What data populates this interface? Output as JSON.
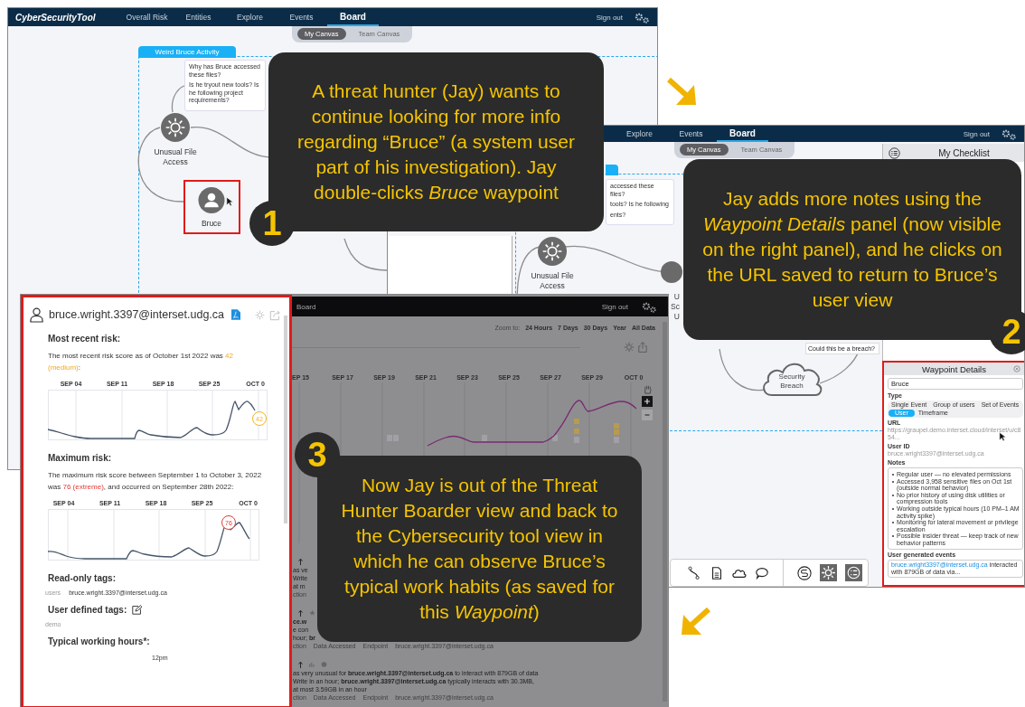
{
  "screen_board": {
    "app_title": "CyberSecurityTool",
    "nav": [
      {
        "label": "Overall Risk",
        "selected": false
      },
      {
        "label": "Entities",
        "selected": false
      },
      {
        "label": "Explore",
        "selected": false
      },
      {
        "label": "Events",
        "selected": false
      },
      {
        "label": "Board",
        "selected": true
      }
    ],
    "sign_out": "Sign out",
    "canvas_tabs": [
      {
        "label": "My Canvas",
        "selected": true
      },
      {
        "label": "Team Canvas",
        "selected": false
      }
    ],
    "group_label": "Weird Bruce Activity",
    "note": [
      "Why has Bruce accessed these files?",
      "Is he tryout new tools? Is he following project requirements?"
    ],
    "nodes": [
      {
        "label": "Unusual File Access",
        "kind": "event",
        "highlighted": false
      },
      {
        "label": "Bruce",
        "kind": "user",
        "highlighted": true
      }
    ]
  },
  "screen_details": {
    "nav": [
      {
        "label": "Explore",
        "selected": false
      },
      {
        "label": "Events",
        "selected": false
      },
      {
        "label": "Board",
        "selected": true
      }
    ],
    "sign_out": "Sign out",
    "canvas_tabs": [
      {
        "label": "My Canvas",
        "selected": true
      },
      {
        "label": "Team Canvas",
        "selected": false
      }
    ],
    "checklist_title": "My Checklist",
    "note_fragments": [
      "accessed these files?",
      "tools? Is he following",
      "ents?"
    ],
    "nodes": [
      {
        "label": "Unusual File Access",
        "kind": "event"
      },
      {
        "label": "Security Breach",
        "kind": "cloud"
      }
    ],
    "node_label_fragments": [
      "U",
      "Sc",
      "U"
    ],
    "breach_note": "Could this be a breach?",
    "waypoint_details": {
      "title": "Waypoint Details",
      "name": "Bruce",
      "type_label": "Type",
      "types": [
        {
          "label": "Single Event",
          "selected": false
        },
        {
          "label": "Group of users",
          "selected": false
        },
        {
          "label": "Set of Events",
          "selected": false
        },
        {
          "label": "User",
          "selected": true
        },
        {
          "label": "Timeframe",
          "selected": false
        }
      ],
      "url_label": "URL",
      "url": "https://graupel.demo.interset.cloud/interset/u/c854...",
      "user_id_label": "User ID",
      "user_id": "bruce.wright3397@interset.udg.ca",
      "notes_label": "Notes",
      "notes": [
        "Regular user — no elevated permissions",
        "Accessed 3,958 sensitive files on Oct 1st (outside normal behavior)",
        "No prior history of using disk utilities or compression tools",
        "Working outside typical hours (10 PM–1 AM activity spike)",
        "Monitoring for lateral movement or privilege escalation",
        "Possible insider threat — keep track of new behavior patterns"
      ],
      "events_label": "User generated events",
      "event": {
        "user": "bruce.wright3397@interset.udg.ca",
        "text": "interacted with 879GB of data via..."
      }
    }
  },
  "screen_user": {
    "email": "bruce.wright.3397@interset.udg.ca",
    "recent_risk": {
      "heading": "Most recent risk:",
      "text": "The most recent risk score as of October 1st 2022 was",
      "score": "42 (medium)",
      "after": ":",
      "ticks": [
        "SEP 04",
        "SEP 11",
        "SEP 18",
        "SEP 25",
        "OCT 0"
      ],
      "badge": "42"
    },
    "max_risk": {
      "heading": "Maximum risk:",
      "text": "The maximum risk score between September 1 to October 3, 2022 was",
      "score": "76 (extreme)",
      "after": ", and occurred on September 28th 2022:",
      "ticks": [
        "SEP 04",
        "SEP 11",
        "SEP 18",
        "SEP 25",
        "OCT 0"
      ],
      "badge": "76"
    },
    "readonly_tags": {
      "heading": "Read-only tags:",
      "label": "users",
      "value": "bruce.wright.3397@interset.udg.ca"
    },
    "user_tags": {
      "heading": "User defined tags:",
      "value": "demo"
    },
    "hours": {
      "heading": "Typical working hours*:",
      "tick": "12pm"
    },
    "tab": "Board",
    "sign_out": "Sign out",
    "zoom_label": "Zoom to:",
    "zoom_options": [
      "24 Hours",
      "7 Days",
      "30 Days",
      "Year",
      "All Data"
    ],
    "timeline_ticks": [
      "EP 15",
      "SEP 17",
      "SEP 19",
      "SEP 21",
      "SEP 23",
      "SEP 25",
      "SEP 27",
      "SEP 29",
      "OCT 0"
    ],
    "events": [
      {
        "kind": "pin",
        "lines": [
          "as ve",
          "Write",
          "at m"
        ],
        "meta": [
          "ction"
        ]
      },
      {
        "kind": "star",
        "lines": [
          "**ce.w**",
          "e con",
          "hour; **br**"
        ],
        "meta": [
          "ction",
          "Data Accessed",
          "Endpoint",
          "bruce.wright.3397@interset.udg.ca"
        ]
      },
      {
        "kind": "pin",
        "lines": [
          "as very unusual for **bruce.wright.3397@interset.udg.ca** to interact with 879GB of data",
          "Write in an hour; **bruce.wright.3397@interset.udg.ca** typically interacts with 30.3MB,",
          "at most 3.59GB in an hour"
        ],
        "meta": [
          "ction",
          "Data Accessed",
          "Endpoint",
          "bruce.wright.3397@interset.udg.ca"
        ]
      }
    ]
  },
  "callouts": [
    {
      "number": "1",
      "text": "A threat hunter (Jay) wants to continue looking for more info regarding “Bruce” (a system user part of his investigation). Jay double-clicks *Bruce* waypoint"
    },
    {
      "number": "2",
      "text": "Jay adds more notes using the *Waypoint Details* panel (now visible on the right panel), and he clicks on the URL saved to return to Bruce’s user view"
    },
    {
      "number": "3",
      "text": "Now Jay is out of the Threat Hunter Boarder view and back to the Cybersecurity tool view in which he can observe Bruce’s typical work habits (as saved for this *Waypoint*)"
    }
  ]
}
